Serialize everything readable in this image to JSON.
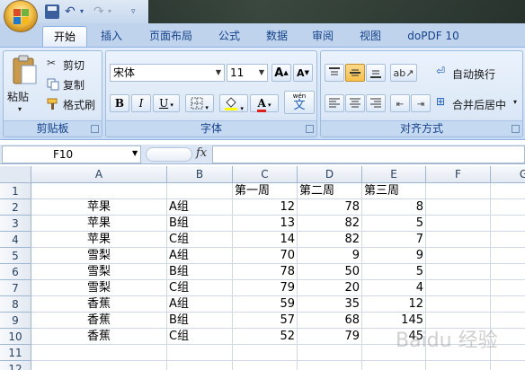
{
  "quick_access": {
    "save": "save-icon",
    "undo": "undo-icon",
    "redo": "redo-icon"
  },
  "tabs": [
    "开始",
    "插入",
    "页面布局",
    "公式",
    "数据",
    "审阅",
    "视图",
    "doPDF 10"
  ],
  "active_tab": "开始",
  "clipboard": {
    "paste_label": "粘贴",
    "cut_label": "剪切",
    "copy_label": "复制",
    "format_painter_label": "格式刷",
    "group_label": "剪贴板"
  },
  "font": {
    "name": "宋体",
    "size": "11",
    "grow_label": "A",
    "shrink_label": "A",
    "bold": "B",
    "italic": "I",
    "underline": "U",
    "font_color_label": "A",
    "phonetic_label": "wén",
    "phonetic_char": "文",
    "group_label": "字体"
  },
  "alignment": {
    "wrap_text_label": "自动换行",
    "merge_center_label": "合并后居中",
    "group_label": "对齐方式"
  },
  "formula_bar": {
    "name_box": "F10",
    "fx_label": "fx",
    "formula": ""
  },
  "grid": {
    "columns": [
      "A",
      "B",
      "C",
      "D",
      "E",
      "F",
      "G"
    ],
    "rows": [
      "1",
      "2",
      "3",
      "4",
      "5",
      "6",
      "7",
      "8",
      "9",
      "10",
      "11",
      "12"
    ],
    "cells": [
      [
        "",
        "",
        "第一周",
        "第二周",
        "第三周",
        "",
        ""
      ],
      [
        "苹果",
        "A组",
        "12",
        "78",
        "8",
        "",
        ""
      ],
      [
        "苹果",
        "B组",
        "13",
        "82",
        "5",
        "",
        ""
      ],
      [
        "苹果",
        "C组",
        "14",
        "82",
        "7",
        "",
        ""
      ],
      [
        "雪梨",
        "A组",
        "70",
        "9",
        "9",
        "",
        ""
      ],
      [
        "雪梨",
        "B组",
        "78",
        "50",
        "5",
        "",
        ""
      ],
      [
        "雪梨",
        "C组",
        "79",
        "20",
        "4",
        "",
        ""
      ],
      [
        "香蕉",
        "A组",
        "59",
        "35",
        "12",
        "",
        ""
      ],
      [
        "香蕉",
        "B组",
        "57",
        "68",
        "145",
        "",
        ""
      ],
      [
        "香蕉",
        "C组",
        "52",
        "79",
        "45",
        "",
        ""
      ],
      [
        "",
        "",
        "",
        "",
        "",
        "",
        ""
      ],
      [
        "",
        "",
        "",
        "",
        "",
        "",
        ""
      ]
    ]
  },
  "watermark": "Baidu 经验"
}
